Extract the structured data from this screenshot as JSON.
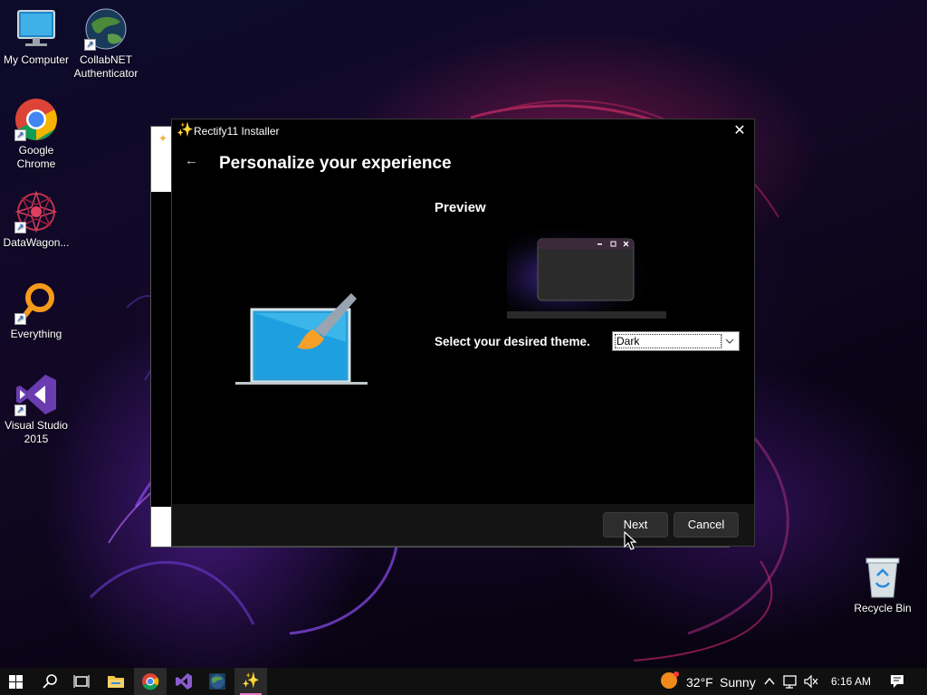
{
  "desktop": {
    "icons": [
      {
        "label": "My Computer",
        "icon": "monitor-icon"
      },
      {
        "label": "CollabNET Authenticator",
        "icon": "globe-icon"
      },
      {
        "label": "Google Chrome",
        "icon": "chrome-icon"
      },
      {
        "label": "DataWagon...",
        "icon": "mandala-icon"
      },
      {
        "label": "Everything",
        "icon": "magnifier-icon"
      },
      {
        "label": "Visual Studio 2015",
        "icon": "visual-studio-icon"
      },
      {
        "label": "Recycle Bin",
        "icon": "recycle-bin-icon"
      }
    ]
  },
  "installer": {
    "title": "Rectify11 Installer",
    "close_glyph": "✕",
    "back_glyph": "←",
    "page_title": "Personalize your experience",
    "preview_label": "Preview",
    "theme_label": "Select your desired theme.",
    "theme_value": "Dark",
    "next_label": "Next",
    "cancel_label": "Cancel"
  },
  "taskbar": {
    "items": [
      {
        "name": "start",
        "icon": "windows-logo-icon"
      },
      {
        "name": "search",
        "icon": "search-icon"
      },
      {
        "name": "task-view",
        "icon": "task-view-icon"
      },
      {
        "name": "file-explorer",
        "icon": "folder-icon"
      },
      {
        "name": "chrome",
        "icon": "chrome-icon"
      },
      {
        "name": "visual-studio",
        "icon": "visual-studio-icon"
      },
      {
        "name": "collabnet",
        "icon": "globe-icon"
      },
      {
        "name": "rectify11-installer",
        "icon": "sparkle-icon"
      }
    ],
    "weather": {
      "temp": "32°F",
      "condition": "Sunny"
    },
    "clock": "6:16 AM",
    "colors": {
      "accent_underline": "#e879c8"
    }
  }
}
